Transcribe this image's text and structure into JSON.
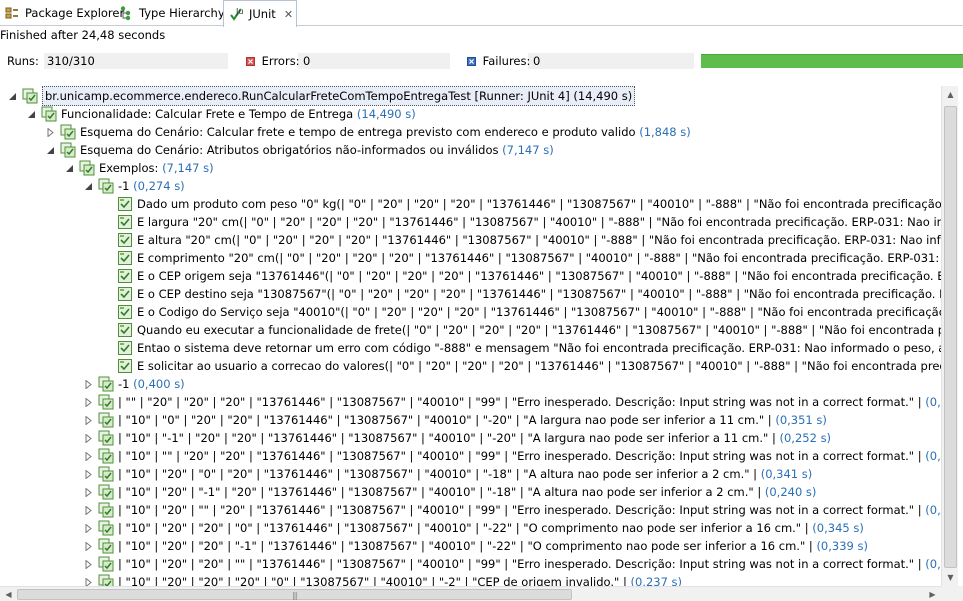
{
  "tabs": [
    {
      "label": "Package Explorer",
      "icon": "package-explorer-icon"
    },
    {
      "label": "Type Hierarchy",
      "icon": "type-hierarchy-icon"
    },
    {
      "label": "JUnit",
      "icon": "junit-icon",
      "active": true,
      "close": "✕"
    }
  ],
  "status": {
    "text": "Finished after 24,48 seconds"
  },
  "counters": {
    "runs_label": "Runs:",
    "runs_value": "310/310",
    "errors_label": "Errors:",
    "errors_value": "0",
    "failures_label": "Failures:",
    "failures_value": "0"
  },
  "progress": {
    "fraction": 1.0,
    "color": "#5ebd4c"
  },
  "tree": [
    {
      "level": 0,
      "twisty": "expanded",
      "icon": "suite",
      "text": "br.unicamp.ecommerce.endereco.RunCalcularFreteComTempoEntregaTest [Runner: JUnit 4]",
      "time": "(14,490 s)",
      "root": true
    },
    {
      "level": 1,
      "twisty": "expanded",
      "icon": "suite",
      "text": "Funcionalidade: Calcular Frete e Tempo de Entrega",
      "time": "(14,490 s)"
    },
    {
      "level": 2,
      "twisty": "collapsed",
      "icon": "suite",
      "text": "Esquema do Cenário: Calcular frete e tempo de entrega previsto com endereco e produto valido",
      "time": "(1,848 s)"
    },
    {
      "level": 2,
      "twisty": "expanded",
      "icon": "suite",
      "text": "Esquema do Cenário: Atributos obrigatórios não-informados ou inválidos",
      "time": "(7,147 s)"
    },
    {
      "level": 3,
      "twisty": "expanded",
      "icon": "suite",
      "text": "Exemplos:",
      "time": "(7,147 s)"
    },
    {
      "level": 4,
      "twisty": "expanded",
      "icon": "suite",
      "text": "-1",
      "time": "(0,274 s)"
    },
    {
      "level": 5,
      "twisty": "none",
      "icon": "test",
      "text": "Dado um produto com peso \"0\" kg(| \"0\" | \"20\" | \"20\" | \"20\" | \"13761446\" | \"13087567\" | \"40010\" | \"-888\" | \"Não foi encontrada precificação. ERP-031: Nao inf",
      "time": ""
    },
    {
      "level": 5,
      "twisty": "none",
      "icon": "test",
      "text": "E largura \"20\" cm(| \"0\" | \"20\" | \"20\" | \"20\" | \"13761446\" | \"13087567\" | \"40010\" | \"-888\" | \"Não foi encontrada precificação. ERP-031: Nao informado o peso, a",
      "time": ""
    },
    {
      "level": 5,
      "twisty": "none",
      "icon": "test",
      "text": "E altura \"20\" cm(| \"0\" | \"20\" | \"20\" | \"20\" | \"13761446\" | \"13087567\" | \"40010\" | \"-888\" | \"Não foi encontrada precificação. ERP-031: Nao informado o peso, a c",
      "time": ""
    },
    {
      "level": 5,
      "twisty": "none",
      "icon": "test",
      "text": "E comprimento \"20\" cm(| \"0\" | \"20\" | \"20\" | \"20\" | \"13761446\" | \"13087567\" | \"40010\" | \"-888\" | \"Não foi encontrada precificação. ERP-031: Nao informado o",
      "time": ""
    },
    {
      "level": 5,
      "twisty": "none",
      "icon": "test",
      "text": "E o CEP origem seja \"13761446\"(| \"0\" | \"20\" | \"20\" | \"20\" | \"13761446\" | \"13087567\" | \"40010\" | \"-888\" | \"Não foi encontrada precificação. ERP-031: Nao inform",
      "time": ""
    },
    {
      "level": 5,
      "twisty": "none",
      "icon": "test",
      "text": "E o CEP destino seja \"13087567\"(| \"0\" | \"20\" | \"20\" | \"20\" | \"13761446\" | \"13087567\" | \"40010\" | \"-888\" | \"Não foi encontrada precificação. ERP-031: Nao infor",
      "time": ""
    },
    {
      "level": 5,
      "twisty": "none",
      "icon": "test",
      "text": "E o Codigo do Serviço seja \"40010\"(| \"0\" | \"20\" | \"20\" | \"20\" | \"13761446\" | \"13087567\" | \"40010\" | \"-888\" | \"Não foi encontrada precificação. ERP-031: Nao inf",
      "time": ""
    },
    {
      "level": 5,
      "twisty": "none",
      "icon": "test",
      "text": "Quando eu executar a funcionalidade de frete(| \"0\" | \"20\" | \"20\" | \"20\" | \"13761446\" | \"13087567\" | \"40010\" | \"-888\" | \"Não foi encontrada precificação. ERP-0",
      "time": ""
    },
    {
      "level": 5,
      "twisty": "none",
      "icon": "test",
      "text": "Entao o sistema deve retornar um erro com código \"-888\" e mensagem \"Não foi encontrada precificação. ERP-031: Nao informado o peso, a quantidade",
      "time": ""
    },
    {
      "level": 5,
      "twisty": "none",
      "icon": "test",
      "text": "E solicitar ao usuario a correcao do valores(| \"0\" | \"20\" | \"20\" | \"20\" | \"13761446\" | \"13087567\" | \"40010\" | \"-888\" | \"Não foi encontrada precificação. ERP-031:",
      "time": ""
    },
    {
      "level": 4,
      "twisty": "collapsed",
      "icon": "suite",
      "text": "-1",
      "time": "(0,400 s)"
    },
    {
      "level": 4,
      "twisty": "collapsed",
      "icon": "suite",
      "text": "| \"\" | \"20\" | \"20\" | \"20\" | \"13761446\" | \"13087567\" | \"40010\" | \"99\" | \"Erro inesperado. Descrição: Input string was not in a correct format.\" |",
      "time": "(0,379 s)"
    },
    {
      "level": 4,
      "twisty": "collapsed",
      "icon": "suite",
      "text": "| \"10\" | \"0\" | \"20\" | \"20\" | \"13761446\" | \"13087567\" | \"40010\" | \"-20\" | \"A largura nao pode ser inferior a 11 cm.\" |",
      "time": "(0,351 s)"
    },
    {
      "level": 4,
      "twisty": "collapsed",
      "icon": "suite",
      "text": "| \"10\" | \"-1\" | \"20\" | \"20\" | \"13761446\" | \"13087567\" | \"40010\" | \"-20\" | \"A largura nao pode ser inferior a 11 cm.\" |",
      "time": "(0,252 s)"
    },
    {
      "level": 4,
      "twisty": "collapsed",
      "icon": "suite",
      "text": "| \"10\" | \"\" | \"20\" | \"20\" | \"13761446\" | \"13087567\" | \"40010\" | \"99\" | \"Erro inesperado. Descrição: Input string was not in a correct format.\" |",
      "time": "(0,352 s)"
    },
    {
      "level": 4,
      "twisty": "collapsed",
      "icon": "suite",
      "text": "| \"10\" | \"20\" | \"0\" | \"20\" | \"13761446\" | \"13087567\" | \"40010\" | \"-18\" | \"A altura nao pode ser inferior a 2 cm.\" |",
      "time": "(0,341 s)"
    },
    {
      "level": 4,
      "twisty": "collapsed",
      "icon": "suite",
      "text": "| \"10\" | \"20\" | \"-1\" | \"20\" | \"13761446\" | \"13087567\" | \"40010\" | \"-18\" | \"A altura nao pode ser inferior a 2 cm.\" |",
      "time": "(0,240 s)"
    },
    {
      "level": 4,
      "twisty": "collapsed",
      "icon": "suite",
      "text": "| \"10\" | \"20\" | \"\" | \"20\" | \"13761446\" | \"13087567\" | \"40010\" | \"99\" | \"Erro inesperado. Descrição: Input string was not in a correct format.\" |",
      "time": "(0,244 s)"
    },
    {
      "level": 4,
      "twisty": "collapsed",
      "icon": "suite",
      "text": "| \"10\" | \"20\" | \"20\" | \"0\" | \"13761446\" | \"13087567\" | \"40010\" | \"-22\" | \"O comprimento nao pode ser inferior a 16 cm.\" |",
      "time": "(0,345 s)"
    },
    {
      "level": 4,
      "twisty": "collapsed",
      "icon": "suite",
      "text": "| \"10\" | \"20\" | \"20\" | \"-1\" | \"13761446\" | \"13087567\" | \"40010\" | \"-22\" | \"O comprimento nao pode ser inferior a 16 cm.\" |",
      "time": "(0,339 s)"
    },
    {
      "level": 4,
      "twisty": "collapsed",
      "icon": "suite",
      "text": "| \"10\" | \"20\" | \"20\" | \"\" | \"13761446\" | \"13087567\" | \"40010\" | \"99\" | \"Erro inesperado. Descrição: Input string was not in a correct format.\" |",
      "time": "(0,339 s)"
    },
    {
      "level": 4,
      "twisty": "collapsed",
      "icon": "suite",
      "text": "| \"10\" | \"20\" | \"20\" | \"20\" | \"0\" | \"13087567\" | \"40010\" | \"-2\" | \"CEP de origem invalido.\" |",
      "time": "(0,237 s)"
    }
  ],
  "scrollbars": {
    "up": "▲",
    "down": "▼",
    "left": "◀",
    "right": "▶",
    "grip": "|||"
  }
}
